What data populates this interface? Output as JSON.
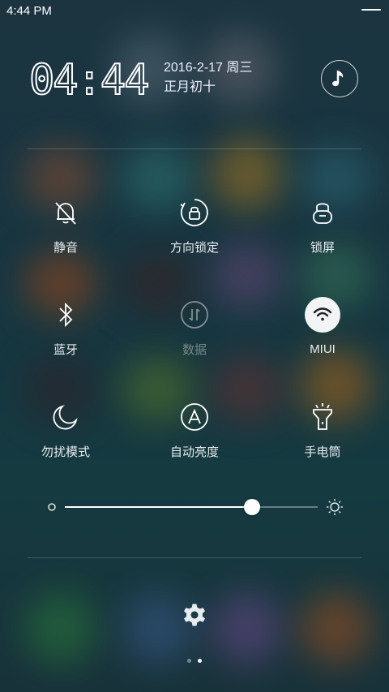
{
  "status_bar": {
    "time": "4:44 PM"
  },
  "clock": {
    "digits": "04:44",
    "date_line": "2016-2-17 周三",
    "lunar_line": "正月初十"
  },
  "toggles": [
    {
      "label": "静音",
      "icon": "bell-off-icon",
      "state": "off"
    },
    {
      "label": "方向锁定",
      "icon": "rotation-lock-icon",
      "state": "off"
    },
    {
      "label": "锁屏",
      "icon": "lock-icon",
      "state": "off"
    },
    {
      "label": "蓝牙",
      "icon": "bluetooth-icon",
      "state": "off"
    },
    {
      "label": "数据",
      "icon": "mobile-data-icon",
      "state": "disabled"
    },
    {
      "label": "MIUI",
      "icon": "wifi-icon",
      "state": "on"
    },
    {
      "label": "勿扰模式",
      "icon": "moon-icon",
      "state": "off"
    },
    {
      "label": "自动亮度",
      "icon": "auto-brightness-icon",
      "state": "off"
    },
    {
      "label": "手电筒",
      "icon": "flashlight-icon",
      "state": "off"
    }
  ],
  "brightness": {
    "level": 0.74
  },
  "pager": {
    "pages": 2,
    "current": 2
  },
  "colors": {
    "active_toggle_bg": "#f2f4f5",
    "text": "#e6ecef"
  }
}
